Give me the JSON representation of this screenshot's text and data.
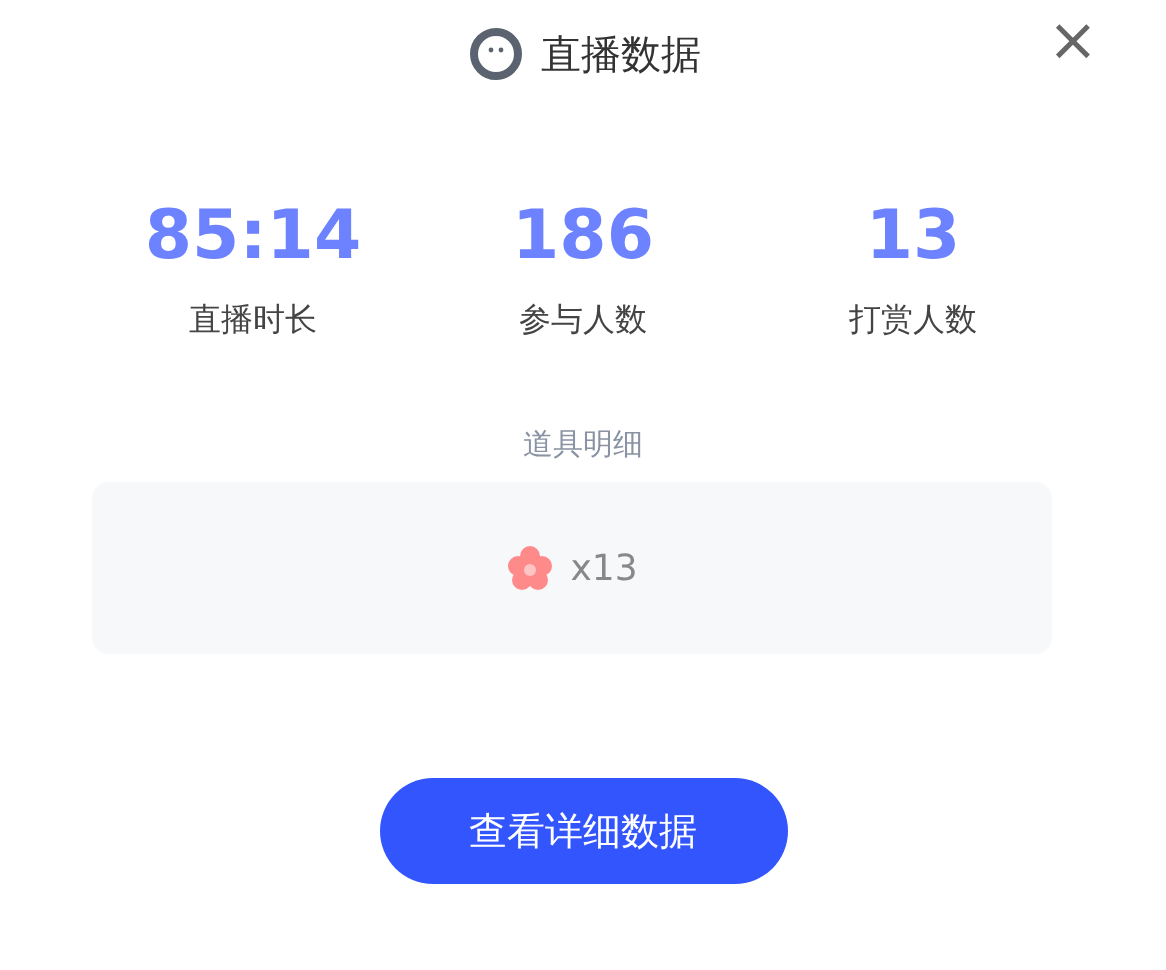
{
  "dialog": {
    "title": "直播数据",
    "close": "×"
  },
  "stats": [
    {
      "value": "85:14",
      "label": "直播时长"
    },
    {
      "value": "186",
      "label": "参与人数"
    },
    {
      "value": "13",
      "label": "打赏人数"
    }
  ],
  "props": {
    "title": "道具明细",
    "items": [
      {
        "count": "x13"
      }
    ]
  },
  "button": "查看详细数据"
}
